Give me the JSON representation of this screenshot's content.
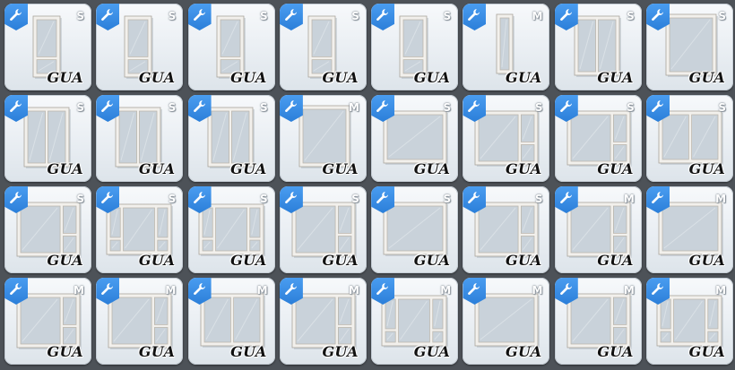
{
  "catalog": {
    "items": [
      {
        "size": "S",
        "label": "GUA",
        "icon": "window-casement-single-icon"
      },
      {
        "size": "S",
        "label": "GUA",
        "icon": "window-casement-single-icon"
      },
      {
        "size": "S",
        "label": "GUA",
        "icon": "window-casement-single-icon"
      },
      {
        "size": "S",
        "label": "GUA",
        "icon": "window-casement-single-icon"
      },
      {
        "size": "S",
        "label": "GUA",
        "icon": "window-casement-single-icon"
      },
      {
        "size": "M",
        "label": "GUA",
        "icon": "window-narrow-tall-icon"
      },
      {
        "size": "S",
        "label": "GUA",
        "icon": "window-double-casement-icon"
      },
      {
        "size": "S",
        "label": "GUA",
        "icon": "window-picture-icon"
      },
      {
        "size": "S",
        "label": "GUA",
        "icon": "window-double-casement-icon"
      },
      {
        "size": "S",
        "label": "GUA",
        "icon": "window-double-casement-icon"
      },
      {
        "size": "S",
        "label": "GUA",
        "icon": "window-double-casement-icon"
      },
      {
        "size": "M",
        "label": "GUA",
        "icon": "window-picture-icon"
      },
      {
        "size": "S",
        "label": "GUA",
        "icon": "window-wide-picture-icon"
      },
      {
        "size": "S",
        "label": "GUA",
        "icon": "window-wide-sidelight-icon"
      },
      {
        "size": "S",
        "label": "GUA",
        "icon": "window-wide-sidelight-icon"
      },
      {
        "size": "S",
        "label": "GUA",
        "icon": "window-wide-double-icon"
      },
      {
        "size": "S",
        "label": "GUA",
        "icon": "window-wide-sidelight-icon"
      },
      {
        "size": "S",
        "label": "GUA",
        "icon": "window-wide-triple-icon"
      },
      {
        "size": "S",
        "label": "GUA",
        "icon": "window-wide-triple-icon"
      },
      {
        "size": "S",
        "label": "GUA",
        "icon": "window-wide-sidelight-icon"
      },
      {
        "size": "S",
        "label": "GUA",
        "icon": "window-wide-picture-icon"
      },
      {
        "size": "S",
        "label": "GUA",
        "icon": "window-wide-sidelight-icon"
      },
      {
        "size": "M",
        "label": "GUA",
        "icon": "window-wide-sidelight-icon"
      },
      {
        "size": "M",
        "label": "GUA",
        "icon": "window-wide-picture-icon"
      },
      {
        "size": "M",
        "label": "GUA",
        "icon": "window-wide-sidelight-icon"
      },
      {
        "size": "M",
        "label": "GUA",
        "icon": "window-wide-sidelight-icon"
      },
      {
        "size": "M",
        "label": "GUA",
        "icon": "window-wide-double-icon"
      },
      {
        "size": "M",
        "label": "GUA",
        "icon": "window-wide-sidelight-icon"
      },
      {
        "size": "M",
        "label": "GUA",
        "icon": "window-wide-triple-icon"
      },
      {
        "size": "M",
        "label": "GUA",
        "icon": "window-wide-picture-icon"
      },
      {
        "size": "M",
        "label": "GUA",
        "icon": "window-wide-sidelight-icon"
      },
      {
        "size": "M",
        "label": "GUA",
        "icon": "window-wide-triple-icon"
      }
    ],
    "badge_icon": "wrench-icon",
    "colors": {
      "badge": "#2b7fd9",
      "frame": "#f2f0ec",
      "glass": "#c9d2da"
    }
  }
}
